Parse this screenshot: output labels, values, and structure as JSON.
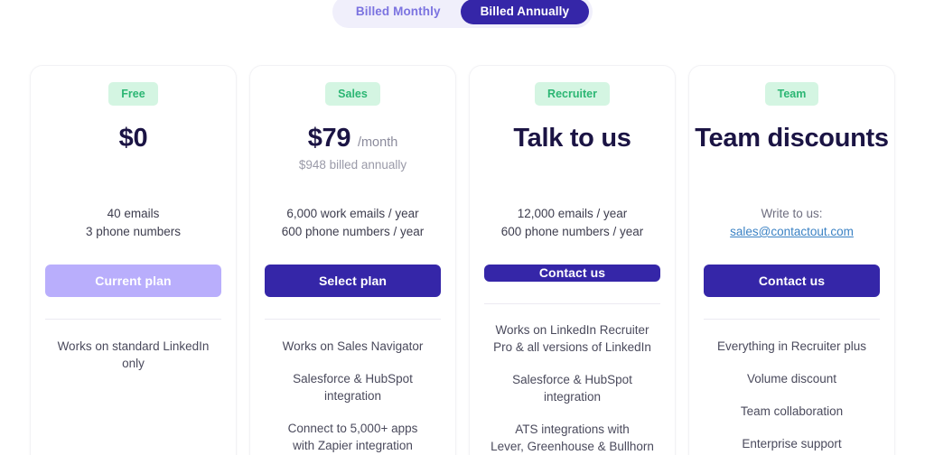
{
  "billing_toggle": {
    "monthly_label": "Billed Monthly",
    "annual_label": "Billed Annually",
    "active": "Billed Annually",
    "active_bg": "#3526a8",
    "inactive_color": "#7b73e0",
    "track_bg": "#f0effb"
  },
  "badge_colors": {
    "bg": "#d4f5e2",
    "text": "#2bb673"
  },
  "plans": [
    {
      "badge": "Free",
      "price": "$0",
      "price_suffix": "",
      "price_sub": "",
      "quota_line_1": "40 emails",
      "quota_line_2": "3 phone numbers",
      "quota_lead": "",
      "email_link": "",
      "cta_label": "Current plan",
      "cta_style": "current",
      "features": [
        "Works on standard LinkedIn only"
      ]
    },
    {
      "badge": "Sales",
      "price": "$79",
      "price_suffix": "/month",
      "price_sub": "$948 billed annually",
      "quota_line_1": "6,000 work emails / year",
      "quota_line_2": "600 phone numbers / year",
      "quota_lead": "",
      "email_link": "",
      "cta_label": "Select plan",
      "cta_style": "primary",
      "features": [
        "Works on Sales Navigator",
        "Salesforce & HubSpot integration",
        "Connect to 5,000+ apps\nwith Zapier integration"
      ]
    },
    {
      "badge": "Recruiter",
      "price": "Talk to us",
      "price_suffix": "",
      "price_sub": "",
      "quota_line_1": "12,000 emails / year",
      "quota_line_2": "600 phone numbers / year",
      "quota_lead": "",
      "email_link": "",
      "cta_label": "Contact us",
      "cta_style": "primary",
      "features": [
        "Works on LinkedIn Recruiter\nPro & all versions of LinkedIn",
        "Salesforce & HubSpot integration",
        "ATS integrations with\nLever, Greenhouse & Bullhorn"
      ]
    },
    {
      "badge": "Team",
      "price": "Team discounts",
      "price_suffix": "",
      "price_sub": "",
      "quota_line_1": "",
      "quota_line_2": "",
      "quota_lead": "Write to us:",
      "email_link": "sales@contactout.com",
      "cta_label": "Contact us",
      "cta_style": "primary",
      "features": [
        "Everything in Recruiter plus",
        "Volume discount",
        "Team collaboration",
        "Enterprise support"
      ]
    }
  ]
}
